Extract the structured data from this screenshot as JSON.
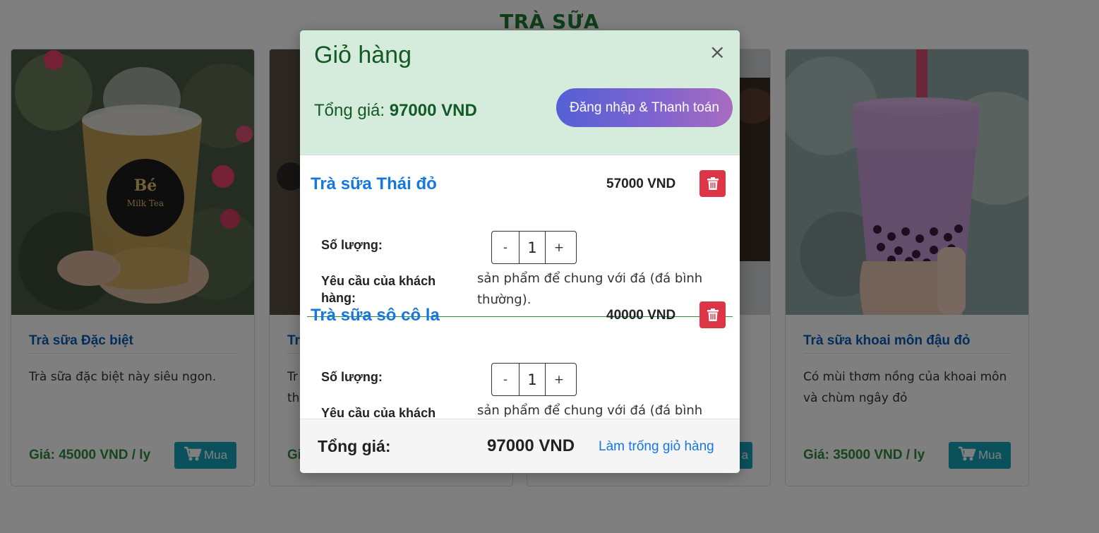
{
  "page": {
    "section_title": "TRÀ SỮA",
    "cards": [
      {
        "name": "Trà sữa Đặc biệt",
        "description": "Trà sữa đặc biệt này siêu ngon.",
        "price": "Giá: 45000 VND / ly",
        "buy_label": "Mua",
        "cup_label": "Bé Milk Tea"
      },
      {
        "name": "Tr",
        "description": "Tr\nth",
        "price": "Gi",
        "buy_label": ""
      },
      {
        "name": "",
        "description": "",
        "price": "",
        "buy_label": "a"
      },
      {
        "name": "Trà sữa khoai môn đậu đỏ",
        "description": "Có mùi thơm nồng của khoai môn và chùm ngây đỏ",
        "price": "Giá: 35000 VND / ly",
        "buy_label": "Mua"
      }
    ]
  },
  "modal": {
    "title": "Giỏ hàng",
    "close_glyph": "×",
    "total_label": "Tổng giá: ",
    "total_value": "97000 VND",
    "login_button": "Đăng nhập & Thanh toán",
    "items": [
      {
        "name": "Trà sữa Thái đỏ",
        "price": "57000 VND",
        "qty_label": "Số lượng:",
        "minus": "-",
        "qty": "1",
        "plus": "+",
        "request_label": "Yêu cầu của khách hàng:",
        "request_text": "sản phẩm để chung với đá (đá bình thường)."
      },
      {
        "name": "Trà sữa sô cô la",
        "price": "40000 VND",
        "qty_label": "Số lượng:",
        "minus": "-",
        "qty": "1",
        "plus": "+",
        "request_label": "Yêu cầu của khách hàng:",
        "request_text": "sản phẩm để chung với đá (đá bình thường)."
      }
    ],
    "footer": {
      "total_label": "Tổng giá:",
      "total_value": "97000 VND",
      "clear_link": "Làm trống giỏ hàng"
    }
  },
  "colors": {
    "accent_green": "#1f7a35",
    "link_blue": "#1677e0",
    "danger": "#dc3545",
    "buy_teal": "#17a2b8"
  },
  "icons": [
    "cart-icon",
    "trash-icon",
    "close-icon"
  ]
}
